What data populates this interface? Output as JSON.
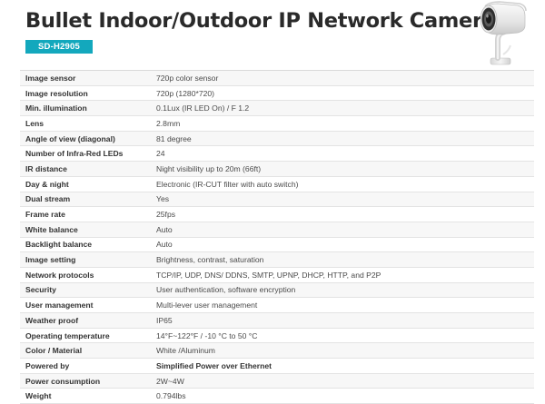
{
  "header": {
    "title": "Bullet Indoor/Outdoor IP Network Camera",
    "model_badge": "SD-H2905",
    "badge_color": "#13a8bd",
    "product_image_icon": "bullet-camera-icon"
  },
  "specs": [
    {
      "label": "Image sensor",
      "value": "720p color sensor"
    },
    {
      "label": "Image resolution",
      "value": "720p (1280*720)"
    },
    {
      "label": "Min. illumination",
      "value": "0.1Lux (IR LED On) / F 1.2"
    },
    {
      "label": "Lens",
      "value": "2.8mm"
    },
    {
      "label": "Angle of view (diagonal)",
      "value": "81 degree"
    },
    {
      "label": "Number of Infra-Red LEDs",
      "value": "24"
    },
    {
      "label": "IR distance",
      "value": "Night visibility up to 20m (66ft)"
    },
    {
      "label": "Day & night",
      "value": "Electronic (IR-CUT filter with auto switch)"
    },
    {
      "label": "Dual stream",
      "value": "Yes"
    },
    {
      "label": "Frame rate",
      "value": "25fps"
    },
    {
      "label": "White balance",
      "value": "Auto"
    },
    {
      "label": "Backlight balance",
      "value": "Auto"
    },
    {
      "label": "Image setting",
      "value": "Brightness, contrast, saturation"
    },
    {
      "label": "Network protocols",
      "value": "TCP/IP, UDP, DNS/ DDNS, SMTP, UPNP, DHCP, HTTP, and P2P"
    },
    {
      "label": "Security",
      "value": "User authentication, software encryption"
    },
    {
      "label": "User management",
      "value": "Multi-lever user management"
    },
    {
      "label": "Weather proof",
      "value": "IP65"
    },
    {
      "label": "Operating temperature",
      "value": "14°F~122°F / -10 °C to 50 °C"
    },
    {
      "label": "Color / Material",
      "value": "White /Aluminum"
    },
    {
      "label": "Powered by",
      "value": "Simplified Power over Ethernet"
    },
    {
      "label": "Power consumption",
      "value": "2W~4W"
    },
    {
      "label": "Weight",
      "value": "0.794lbs"
    }
  ]
}
